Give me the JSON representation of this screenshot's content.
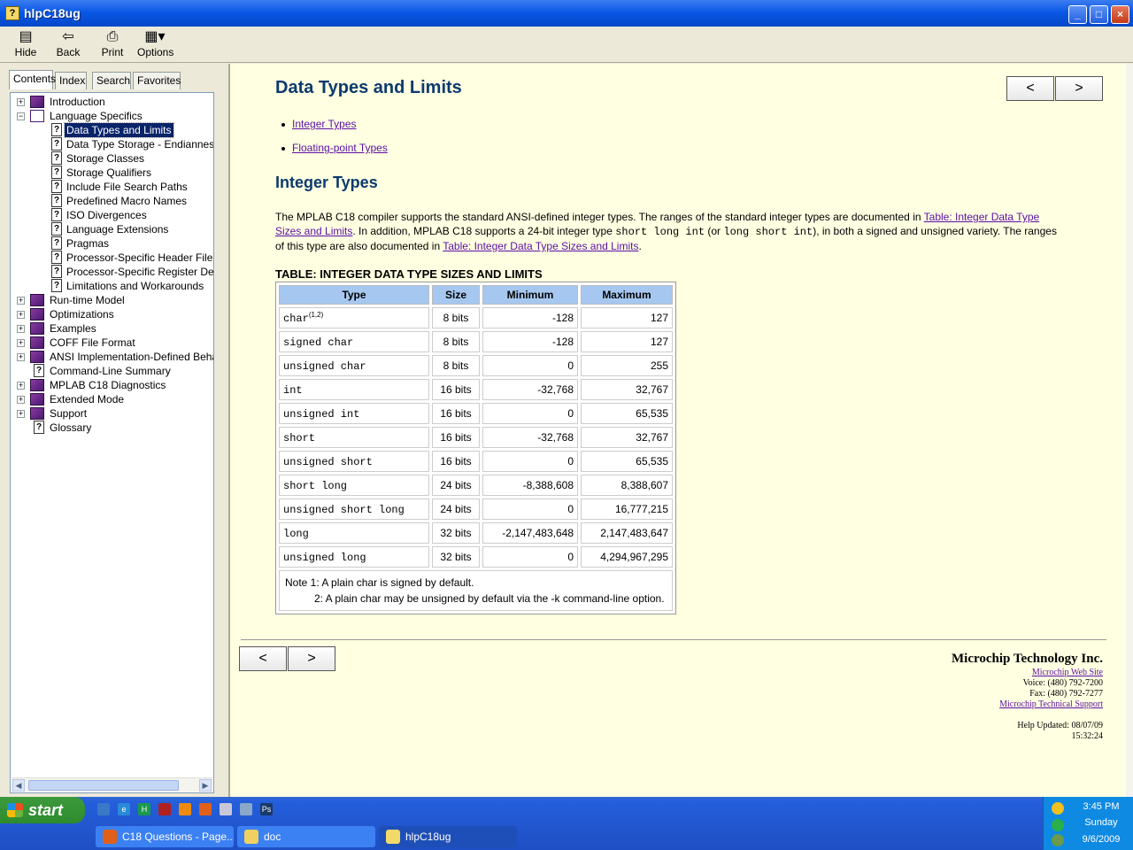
{
  "window": {
    "title": "hlpC18ug",
    "minimize": "_",
    "maximize": "□",
    "close": "×"
  },
  "toolbar": {
    "hide": "Hide",
    "back": "Back",
    "print": "Print",
    "options": "Options"
  },
  "tabs": [
    "Contents",
    "Index",
    "Search",
    "Favorites"
  ],
  "tree": [
    {
      "label": "Introduction",
      "type": "book",
      "expander": "+"
    },
    {
      "label": "Language Specifics",
      "type": "book-open",
      "expander": "−"
    },
    {
      "label": "Data Types and Limits",
      "type": "page",
      "selected": true
    },
    {
      "label": "Data Type Storage - Endianness",
      "type": "page"
    },
    {
      "label": "Storage Classes",
      "type": "page"
    },
    {
      "label": "Storage Qualifiers",
      "type": "page"
    },
    {
      "label": "Include File Search Paths",
      "type": "page"
    },
    {
      "label": "Predefined Macro Names",
      "type": "page"
    },
    {
      "label": "ISO Divergences",
      "type": "page"
    },
    {
      "label": "Language Extensions",
      "type": "page"
    },
    {
      "label": "Pragmas",
      "type": "page"
    },
    {
      "label": "Processor-Specific Header Files",
      "type": "page"
    },
    {
      "label": "Processor-Specific Register Definiti",
      "type": "page"
    },
    {
      "label": "Limitations and Workarounds",
      "type": "page"
    },
    {
      "label": "Run-time Model",
      "type": "book",
      "expander": "+"
    },
    {
      "label": "Optimizations",
      "type": "book",
      "expander": "+"
    },
    {
      "label": "Examples",
      "type": "book",
      "expander": "+"
    },
    {
      "label": "COFF File Format",
      "type": "book",
      "expander": "+"
    },
    {
      "label": "ANSI Implementation-Defined Behavior",
      "type": "book",
      "expander": "+"
    },
    {
      "label": "Command-Line Summary",
      "type": "page"
    },
    {
      "label": "MPLAB C18 Diagnostics",
      "type": "book",
      "expander": "+"
    },
    {
      "label": "Extended Mode",
      "type": "book",
      "expander": "+"
    },
    {
      "label": "Support",
      "type": "book",
      "expander": "+"
    },
    {
      "label": "Glossary",
      "type": "page"
    }
  ],
  "content": {
    "title": "Data Types and Limits",
    "links": [
      "Integer Types",
      "Floating-point Types"
    ],
    "section_title": "Integer Types",
    "para": {
      "t1": "The MPLAB C18 compiler supports the standard ANSI-defined integer types. The ranges of the standard integer types are documented in ",
      "link1": "Table: Integer Data Type Sizes and Limits",
      "t2": ". In addition, MPLAB C18 supports a 24-bit integer type ",
      "code1": "short long int",
      "t3": " (or ",
      "code2": "long short int",
      "t4": "), in both a signed and unsigned variety. The ranges of this type are also documented in ",
      "link2": "Table: Integer Data Type Sizes and Limits",
      "t5": "."
    },
    "table_caption": "TABLE: INTEGER DATA TYPE SIZES AND LIMITS",
    "table_headers": [
      "Type",
      "Size",
      "Minimum",
      "Maximum"
    ],
    "first_row_sup": "(1,2)",
    "table_rows": [
      [
        "char",
        "8 bits",
        "-128",
        "127"
      ],
      [
        "signed char",
        "8 bits",
        "-128",
        "127"
      ],
      [
        "unsigned char",
        "8 bits",
        "0",
        "255"
      ],
      [
        "int",
        "16 bits",
        "-32,768",
        "32,767"
      ],
      [
        "unsigned int",
        "16 bits",
        "0",
        "65,535"
      ],
      [
        "short",
        "16 bits",
        "-32,768",
        "32,767"
      ],
      [
        "unsigned short",
        "16 bits",
        "0",
        "65,535"
      ],
      [
        "short long",
        "24 bits",
        "-8,388,608",
        "8,388,607"
      ],
      [
        "unsigned short long",
        "24 bits",
        "0",
        "16,777,215"
      ],
      [
        "long",
        "32 bits",
        "-2,147,483,648",
        "2,147,483,647"
      ],
      [
        "unsigned long",
        "32 bits",
        "0",
        "4,294,967,295"
      ]
    ],
    "notes": [
      "Note 1: A plain char is signed by default.",
      "2: A plain char may be unsigned by default via the -k command-line option."
    ],
    "prev": "<",
    "next": ">"
  },
  "footer": {
    "company": "Microchip Technology Inc.",
    "website": "Microchip Web Site",
    "voice": "Voice: (480) 792-7200",
    "fax": "Fax: (480) 792-7277",
    "support": "Microchip Technical Support",
    "updated_label": "Help Updated: 08/07/09",
    "updated_time": "15:32:24"
  },
  "taskbar": {
    "start": "start",
    "tasks": [
      "C18 Questions - Page...",
      "doc",
      "hlpC18ug"
    ],
    "clock": {
      "time": "3:45 PM",
      "day": "Sunday",
      "date": "9/6/2009"
    }
  }
}
